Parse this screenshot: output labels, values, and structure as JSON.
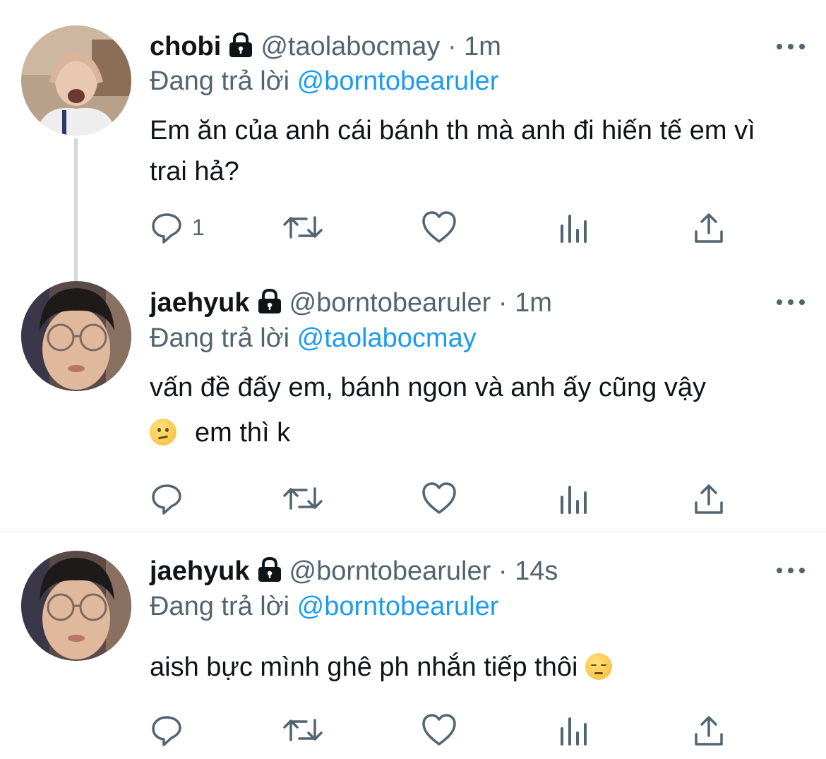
{
  "tweets": [
    {
      "name": "chobi",
      "handle": "@taolabocmay",
      "separator": "·",
      "time": "1m",
      "replying_prefix": "Đang trả lời",
      "replying_to": "@borntobearuler",
      "text": "Em ăn của anh cái bánh th mà anh đi hiến tế em vì trai hả?",
      "reply_count": "1",
      "avatar_icon": "avatar-photo"
    },
    {
      "name": "jaehyuk",
      "handle": "@borntobearuler",
      "separator": "·",
      "time": "1m",
      "replying_prefix": "Đang trả lời",
      "replying_to": "@taolabocmay",
      "text_line1": "vấn đề đấy em, bánh ngon và anh ấy cũng vậy",
      "text_line2": "em thì k",
      "reply_count": "",
      "emoji": "confused-face"
    },
    {
      "name": "jaehyuk",
      "handle": "@borntobearuler",
      "separator": "·",
      "time": "14s",
      "replying_prefix": "Đang trả lời",
      "replying_to": "@borntobearuler",
      "text": "aish bực mình ghê ph nhắn tiếp thôi",
      "reply_count": "",
      "emoji": "pensive-face"
    }
  ],
  "colors": {
    "accent": "#1d9bf0",
    "secondary_text": "#536471",
    "primary_text": "#0f1419",
    "divider": "#eff3f4",
    "thread_line": "#cfd9de"
  }
}
